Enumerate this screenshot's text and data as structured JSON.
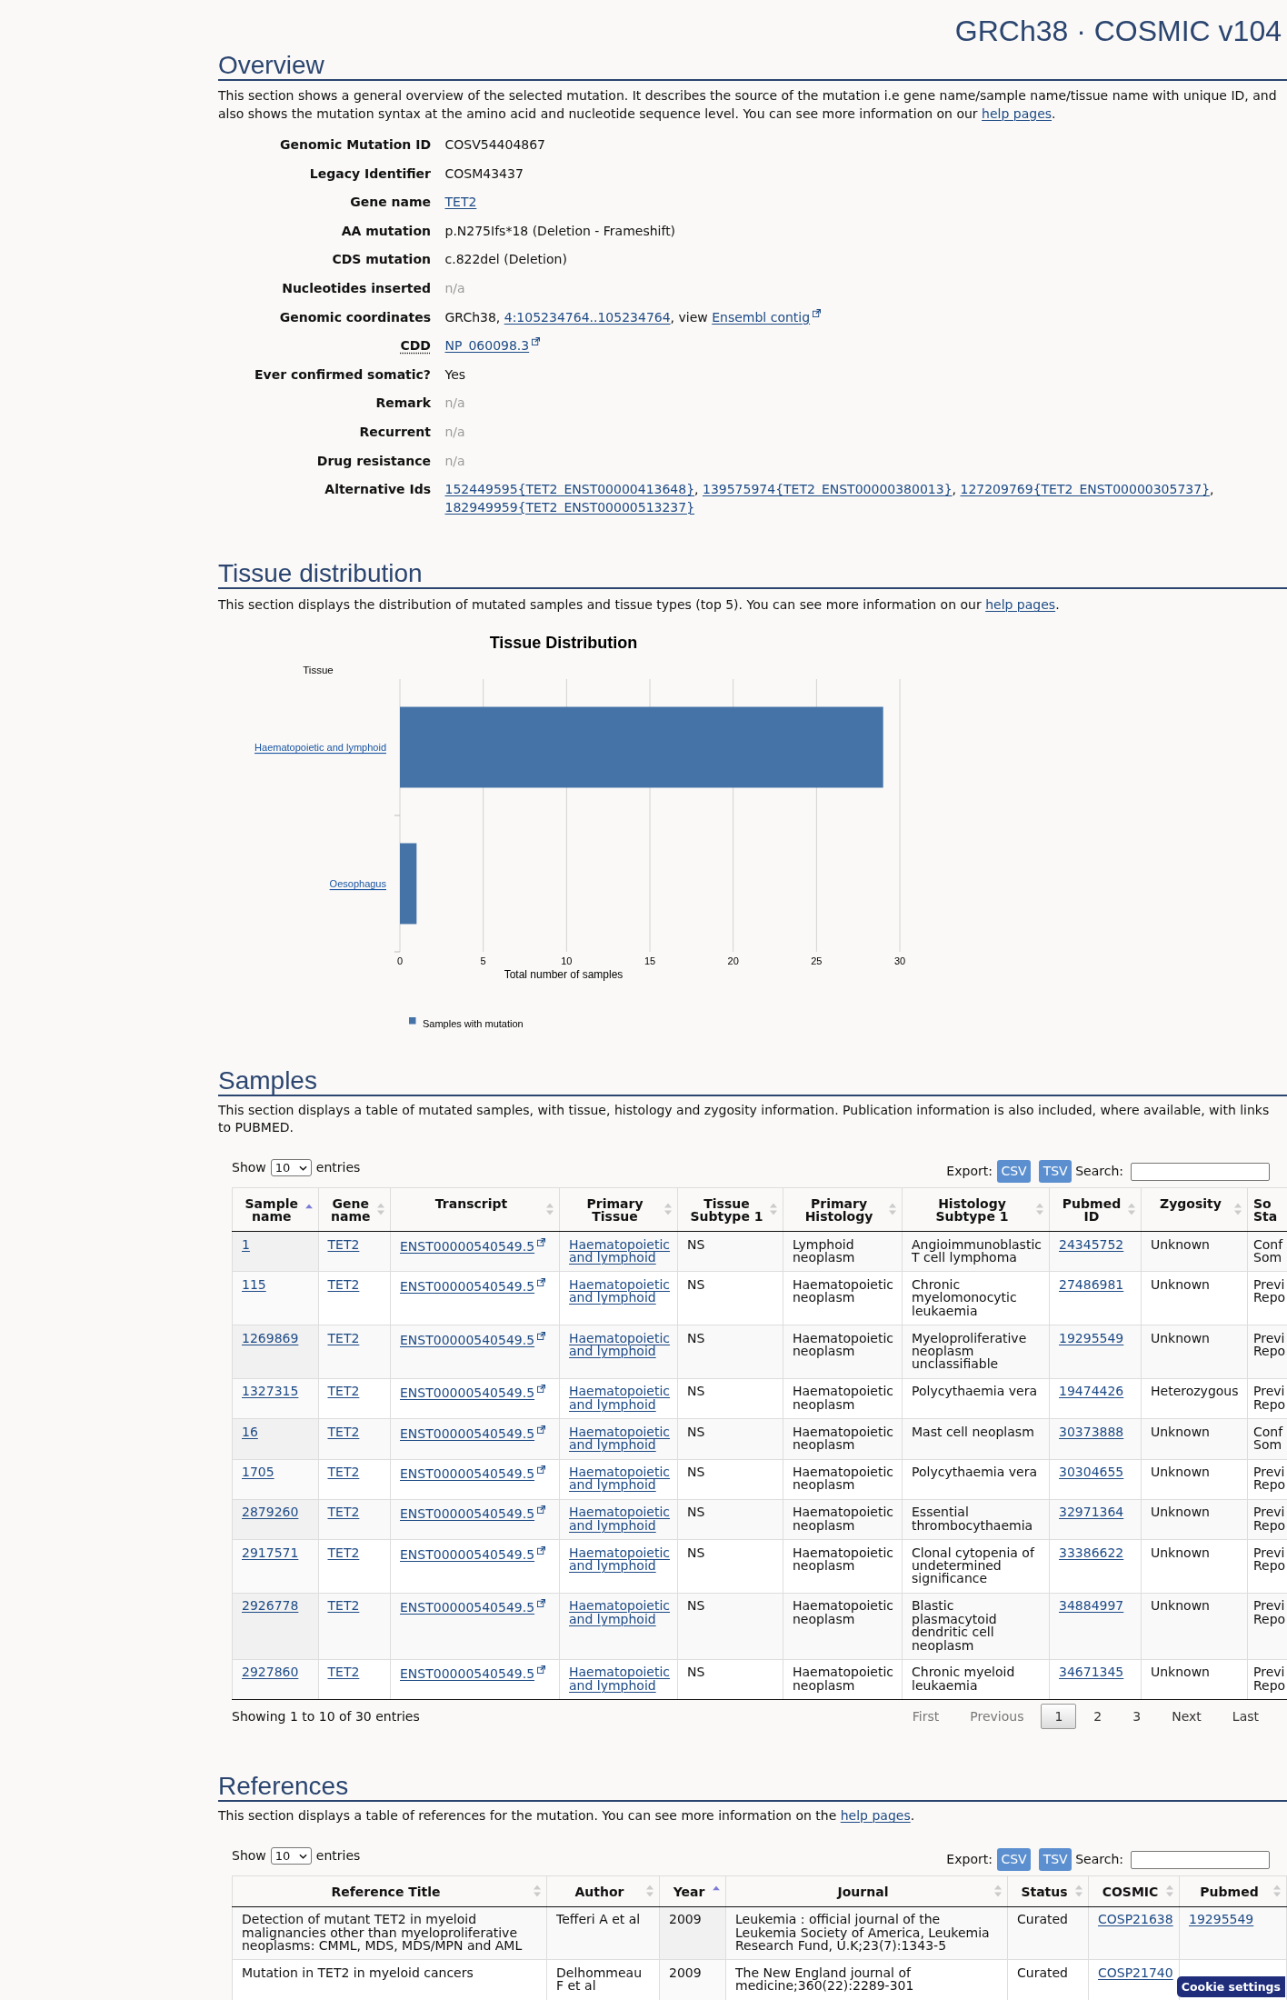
{
  "header": {
    "title": "GRCh38 · COSMIC v104"
  },
  "overview": {
    "heading": "Overview",
    "description": {
      "text": "This section shows a general overview of the selected mutation. It describes the source of the mutation i.e gene name/sample name/tissue name with unique ID, and also shows the mutation syntax at the amino acid and nucleotide sequence level. You can see more information on our ",
      "link": "help pages",
      "after": "."
    },
    "rows": [
      {
        "label": "Genomic Mutation ID",
        "abbreviation": false,
        "value": [
          {
            "kind": "text",
            "text": "COSV54404867"
          }
        ]
      },
      {
        "label": "Legacy Identifier",
        "abbreviation": false,
        "value": [
          {
            "kind": "text",
            "text": "COSM43437"
          }
        ]
      },
      {
        "label": "Gene name",
        "abbreviation": false,
        "value": [
          {
            "kind": "link",
            "text": "TET2"
          }
        ]
      },
      {
        "label": "AA mutation",
        "abbreviation": false,
        "value": [
          {
            "kind": "text",
            "text": "p.N275Ifs*18 (Deletion - Frameshift)"
          }
        ]
      },
      {
        "label": "CDS mutation",
        "abbreviation": false,
        "value": [
          {
            "kind": "text",
            "text": "c.822del (Deletion)"
          }
        ]
      },
      {
        "label": "Nucleotides inserted",
        "abbreviation": false,
        "value": [
          {
            "kind": "muted",
            "text": "n/a"
          }
        ]
      },
      {
        "label": "Genomic coordinates",
        "abbreviation": false,
        "value": [
          {
            "kind": "text",
            "text": "GRCh38, "
          },
          {
            "kind": "link",
            "text": "4:105234764..105234764"
          },
          {
            "kind": "text",
            "text": ", view "
          },
          {
            "kind": "external_link",
            "text": "Ensembl contig"
          }
        ]
      },
      {
        "label": "CDD",
        "abbreviation": true,
        "value": [
          {
            "kind": "external_link",
            "text": "NP_060098.3"
          }
        ]
      },
      {
        "label": "Ever confirmed somatic?",
        "abbreviation": false,
        "value": [
          {
            "kind": "text",
            "text": "Yes"
          }
        ]
      },
      {
        "label": "Remark",
        "abbreviation": false,
        "value": [
          {
            "kind": "muted",
            "text": "n/a"
          }
        ]
      },
      {
        "label": "Recurrent",
        "abbreviation": false,
        "value": [
          {
            "kind": "muted",
            "text": "n/a"
          }
        ]
      },
      {
        "label": "Drug resistance",
        "abbreviation": false,
        "value": [
          {
            "kind": "muted",
            "text": "n/a"
          }
        ]
      },
      {
        "label": "Alternative Ids",
        "abbreviation": false,
        "value": [
          {
            "kind": "link",
            "text": "152449595{TET2_ENST00000413648}"
          },
          {
            "kind": "text",
            "text": ", "
          },
          {
            "kind": "link",
            "text": "139575974{TET2_ENST00000380013}"
          },
          {
            "kind": "text",
            "text": ", "
          },
          {
            "kind": "link",
            "text": "127209769{TET2_ENST00000305737}"
          },
          {
            "kind": "text",
            "text": ", "
          },
          {
            "kind": "link",
            "text": "182949959{TET2_ENST00000513237}"
          }
        ]
      }
    ]
  },
  "tissue_distribution": {
    "heading": "Tissue distribution",
    "description": {
      "text": "This section displays the distribution of mutated samples and tissue types (top 5). You can see more information on our ",
      "link": "help pages",
      "after": "."
    },
    "chart_data": {
      "type": "bar",
      "orientation": "horizontal",
      "title": "Tissue Distribution",
      "xlabel": "Total number of samples",
      "ylabel": "Tissue",
      "categories": [
        "Haematopoietic and lymphoid",
        "Oesophagus"
      ],
      "series": [
        {
          "name": "Samples with mutation",
          "color": "#4573a7",
          "values": [
            29,
            1
          ]
        }
      ],
      "xlim": [
        0,
        30
      ],
      "xticks": [
        0,
        5,
        10,
        15,
        20,
        25,
        30
      ],
      "grid": true
    }
  },
  "samples": {
    "heading": "Samples",
    "description": {
      "text": "This section displays a table of mutated samples, with tissue, histology and zygosity information. Publication information is also included, where available, with links to PUBMED."
    },
    "controls": {
      "show_label": "Show",
      "entries_value": "10",
      "entries_label": "entries",
      "export_label": "Export:",
      "export_buttons": [
        "CSV",
        "TSV"
      ],
      "search_label": "Search:"
    },
    "table": {
      "columns": [
        {
          "label": "Sample name",
          "kind": "link",
          "sorted": true
        },
        {
          "label": "Gene name",
          "kind": "link",
          "sorted": false
        },
        {
          "label": "Transcript",
          "kind": "external_link",
          "sorted": false
        },
        {
          "label": "Primary Tissue",
          "kind": "link",
          "sorted": false
        },
        {
          "label": "Tissue Subtype 1",
          "kind": "text",
          "sorted": false
        },
        {
          "label": "Primary Histology",
          "kind": "text",
          "sorted": false
        },
        {
          "label": "Histology Subtype 1",
          "kind": "text",
          "sorted": false
        },
        {
          "label": "Pubmed ID",
          "kind": "link",
          "sorted": false
        },
        {
          "label": "Zygosity",
          "kind": "text",
          "sorted": false
        },
        {
          "label": "So Sta",
          "kind": "text"
        }
      ],
      "rows": [
        [
          "1",
          "TET2",
          "ENST00000540549.5",
          "Haematopoietic and lymphoid",
          "NS",
          "Lymphoid neoplasm",
          "Angioimmunoblastic T cell lymphoma",
          "24345752",
          "Unknown",
          "Conf Som"
        ],
        [
          "115",
          "TET2",
          "ENST00000540549.5",
          "Haematopoietic and lymphoid",
          "NS",
          "Haematopoietic neoplasm",
          "Chronic myelomonocytic leukaemia",
          "27486981",
          "Unknown",
          "Previ Repo"
        ],
        [
          "1269869",
          "TET2",
          "ENST00000540549.5",
          "Haematopoietic and lymphoid",
          "NS",
          "Haematopoietic neoplasm",
          "Myeloproliferative neoplasm unclassifiable",
          "19295549",
          "Unknown",
          "Previ Repo"
        ],
        [
          "1327315",
          "TET2",
          "ENST00000540549.5",
          "Haematopoietic and lymphoid",
          "NS",
          "Haematopoietic neoplasm",
          "Polycythaemia vera",
          "19474426",
          "Heterozygous",
          "Previ Repo"
        ],
        [
          "16",
          "TET2",
          "ENST00000540549.5",
          "Haematopoietic and lymphoid",
          "NS",
          "Haematopoietic neoplasm",
          "Mast cell neoplasm",
          "30373888",
          "Unknown",
          "Conf Som"
        ],
        [
          "1705",
          "TET2",
          "ENST00000540549.5",
          "Haematopoietic and lymphoid",
          "NS",
          "Haematopoietic neoplasm",
          "Polycythaemia vera",
          "30304655",
          "Unknown",
          "Previ Repo"
        ],
        [
          "2879260",
          "TET2",
          "ENST00000540549.5",
          "Haematopoietic and lymphoid",
          "NS",
          "Haematopoietic neoplasm",
          "Essential thrombocythaemia",
          "32971364",
          "Unknown",
          "Previ Repo"
        ],
        [
          "2917571",
          "TET2",
          "ENST00000540549.5",
          "Haematopoietic and lymphoid",
          "NS",
          "Haematopoietic neoplasm",
          "Clonal cytopenia of undetermined significance",
          "33386622",
          "Unknown",
          "Previ Repo"
        ],
        [
          "2926778",
          "TET2",
          "ENST00000540549.5",
          "Haematopoietic and lymphoid",
          "NS",
          "Haematopoietic neoplasm",
          "Blastic plasmacytoid dendritic cell neoplasm",
          "34884997",
          "Unknown",
          "Previ Repo"
        ],
        [
          "2927860",
          "TET2",
          "ENST00000540549.5",
          "Haematopoietic and lymphoid",
          "NS",
          "Haematopoietic neoplasm",
          "Chronic myeloid leukaemia",
          "34671345",
          "Unknown",
          "Previ Repo"
        ]
      ]
    },
    "info": "Showing 1 to 10 of 30 entries",
    "pagination": [
      {
        "label": "First",
        "kind": "nav",
        "disabled": true
      },
      {
        "label": "Previous",
        "kind": "nav",
        "disabled": true
      },
      {
        "label": "1",
        "kind": "page",
        "selected": true
      },
      {
        "label": "2",
        "kind": "page",
        "selected": false
      },
      {
        "label": "3",
        "kind": "page",
        "selected": false
      },
      {
        "label": "Next",
        "kind": "nav",
        "disabled": false
      },
      {
        "label": "Last",
        "kind": "nav",
        "disabled": false
      }
    ]
  },
  "references": {
    "heading": "References",
    "description": {
      "text": "This section displays a table of references for the mutation. You can see more information on the ",
      "link": "help pages",
      "after": "."
    },
    "controls": {
      "show_label": "Show",
      "entries_value": "10",
      "entries_label": "entries",
      "export_label": "Export:",
      "export_buttons": [
        "CSV",
        "TSV"
      ],
      "search_label": "Search:"
    },
    "table": {
      "columns": [
        {
          "label": "Reference Title",
          "kind": "text",
          "sorted": false
        },
        {
          "label": "Author",
          "kind": "text",
          "sorted": false
        },
        {
          "label": "Year",
          "kind": "text",
          "sorted": true
        },
        {
          "label": "Journal",
          "kind": "text",
          "sorted": false
        },
        {
          "label": "Status",
          "kind": "text",
          "sorted": false
        },
        {
          "label": "COSMIC",
          "kind": "link",
          "sorted": false
        },
        {
          "label": "Pubmed",
          "kind": "link",
          "sorted": false
        }
      ],
      "rows": [
        [
          "Detection of mutant TET2 in myeloid malignancies other than myeloproliferative neoplasms: CMML, MDS, MDS/MPN and AML",
          "Tefferi A et al",
          "2009",
          "Leukemia : official journal of the Leukemia Society of America, Leukemia Research Fund, U.K;23(7):1343-5",
          "Curated",
          "COSP21638",
          "19295549"
        ],
        [
          "Mutation in TET2 in myeloid cancers",
          "Delhommeau F et al",
          "2009",
          "The New England journal of medicine;360(22):2289-301",
          "Curated",
          "COSP21740"
        ]
      ]
    }
  },
  "cookie_button": {
    "label": "Cookie settings"
  }
}
